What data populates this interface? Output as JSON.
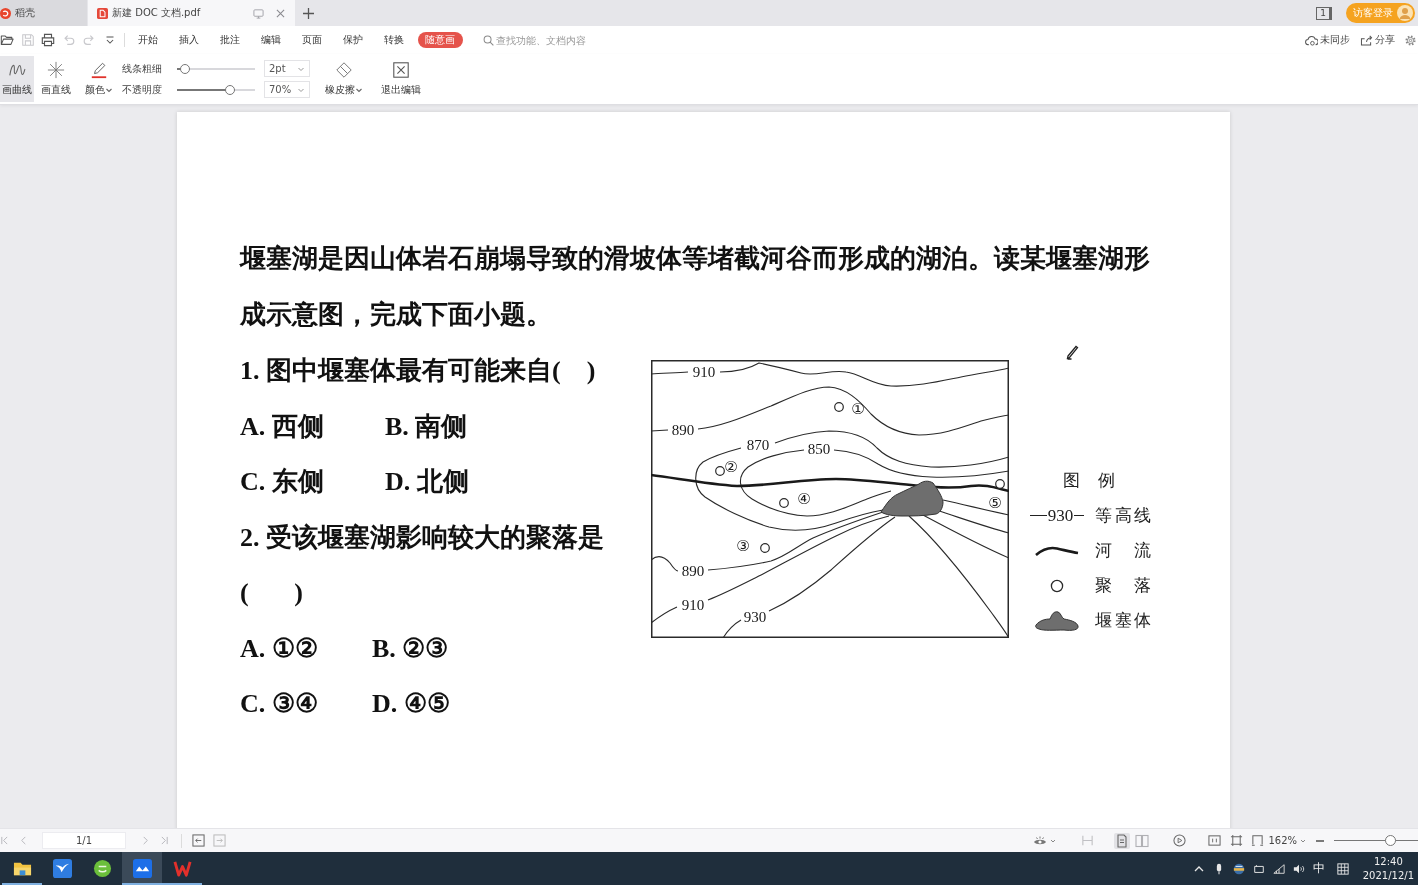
{
  "tabs": [
    {
      "label": "稻壳",
      "kind": "home",
      "selected": false
    },
    {
      "label": "新建 DOC 文档.pdf",
      "kind": "pdf",
      "selected": true
    }
  ],
  "title_bar": {
    "window_count": "1",
    "login": "访客登录"
  },
  "quick_access": [
    {
      "kind": "open",
      "disabled": false
    },
    {
      "kind": "save",
      "disabled": true
    },
    {
      "kind": "print",
      "disabled": false
    },
    {
      "kind": "undo",
      "disabled": true
    },
    {
      "kind": "redo",
      "disabled": true
    }
  ],
  "menu": [
    {
      "label": "开始",
      "selected": false
    },
    {
      "label": "插入",
      "selected": false
    },
    {
      "label": "批注",
      "selected": false
    },
    {
      "label": "编辑",
      "selected": false
    },
    {
      "label": "页面",
      "selected": false
    },
    {
      "label": "保护",
      "selected": false
    },
    {
      "label": "转换",
      "selected": false
    },
    {
      "label": "随意画",
      "selected": true
    }
  ],
  "search": {
    "placeholder": "查找功能、文档内容"
  },
  "menu_right": [
    {
      "kind": "sync",
      "label": "未同步"
    },
    {
      "kind": "share",
      "label": "分享"
    }
  ],
  "draw_tools": [
    {
      "kind": "curve",
      "label": "画曲线",
      "selected": true,
      "dropdown": false
    },
    {
      "kind": "line",
      "label": "画直线",
      "selected": false,
      "dropdown": false
    },
    {
      "kind": "color",
      "label": "颜色",
      "selected": false,
      "dropdown": true
    }
  ],
  "sliders": [
    {
      "label": "线条粗细",
      "level": 0.05,
      "value": "2pt"
    },
    {
      "label": "不透明度",
      "level": 0.7,
      "value": "70%"
    }
  ],
  "edit_tools": [
    {
      "kind": "eraser",
      "label": "橡皮擦",
      "dropdown": true
    },
    {
      "kind": "exit",
      "label": "退出编辑",
      "dropdown": false
    }
  ],
  "document": {
    "intro": "堰塞湖是因山体岩石崩塌导致的滑坡体等堵截河谷而形成的湖泊。读某堰塞湖形成示意图，完成下面小题。",
    "questions": [
      {
        "stem": "1. 图中堰塞体最有可能来自",
        "blank": "(    )",
        "options": [
          "A. 西侧",
          "B. 南侧",
          "C. 东侧",
          "D. 北侧"
        ]
      },
      {
        "stem": "2. 受该堰塞湖影响较大的聚落是",
        "blank": "(       )",
        "options": [
          "A. ①②",
          "B. ②③",
          "C. ③④",
          "D. ④⑤"
        ]
      }
    ],
    "map": {
      "contour_labels": [
        "910",
        "890",
        "870",
        "850",
        "890",
        "910",
        "930"
      ],
      "settlement_labels": [
        "①",
        "②",
        "③",
        "④",
        "⑤"
      ],
      "legend_title": "图 例",
      "legend": [
        {
          "kind": "contour",
          "sample": "930",
          "label": "等高线"
        },
        {
          "kind": "river",
          "label": "河 流"
        },
        {
          "kind": "settlement",
          "label": "聚 落"
        },
        {
          "kind": "dam",
          "label": "堰塞体"
        }
      ]
    }
  },
  "status_bar": {
    "page": "1/1",
    "view_modes": [
      {
        "kind": "single",
        "selected": true
      },
      {
        "kind": "double",
        "selected": false
      }
    ],
    "zoom": "162%",
    "zoom_slider": {
      "level": 0.7
    }
  },
  "taskbar": {
    "apps": [
      {
        "kind": "folder",
        "open": true,
        "selected": false
      },
      {
        "kind": "bird",
        "open": false,
        "selected": false
      },
      {
        "kind": "round",
        "open": false,
        "selected": false
      },
      {
        "kind": "wave",
        "open": true,
        "selected": true
      },
      {
        "kind": "zigzag",
        "open": true,
        "selected": false
      }
    ],
    "ime": "中",
    "time": "12:40",
    "date": "2021/12/1"
  }
}
